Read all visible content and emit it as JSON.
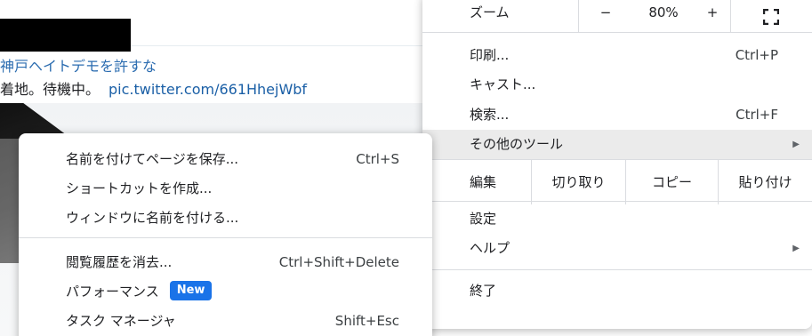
{
  "tweet": {
    "hashtag_line": "神戸ヘイトデモを許すな",
    "text_line": "着地。待機中。",
    "link": "pic.twitter.com/661HhejWbf"
  },
  "main_menu": {
    "zoom": {
      "label": "ズーム",
      "minus": "−",
      "value": "80%",
      "plus": "+",
      "fullscreen_icon": "fullscreen-icon"
    },
    "print": {
      "label": "印刷...",
      "shortcut": "Ctrl+P"
    },
    "cast": {
      "label": "キャスト..."
    },
    "find": {
      "label": "検索...",
      "shortcut": "Ctrl+F"
    },
    "more_tools": {
      "label": "その他のツール",
      "arrow": "▶"
    },
    "edit": {
      "label": "編集",
      "cut": "切り取り",
      "copy": "コピー",
      "paste": "貼り付け"
    },
    "settings": {
      "label": "設定"
    },
    "help": {
      "label": "ヘルプ",
      "arrow": "▶"
    },
    "exit": {
      "label": "終了"
    }
  },
  "sub_menu": {
    "save_page": {
      "label": "名前を付けてページを保存...",
      "shortcut": "Ctrl+S"
    },
    "create_shortcut": {
      "label": "ショートカットを作成..."
    },
    "name_window": {
      "label": "ウィンドウに名前を付ける..."
    },
    "clear_history": {
      "label": "閲覧履歴を消去...",
      "shortcut": "Ctrl+Shift+Delete"
    },
    "performance": {
      "label": "パフォーマンス",
      "badge": "New"
    },
    "task_manager": {
      "label": "タスク マネージャ",
      "shortcut": "Shift+Esc"
    }
  },
  "colors": {
    "highlight": "#ebebeb",
    "badge": "#1a73e8",
    "link": "#1a5fa6"
  }
}
